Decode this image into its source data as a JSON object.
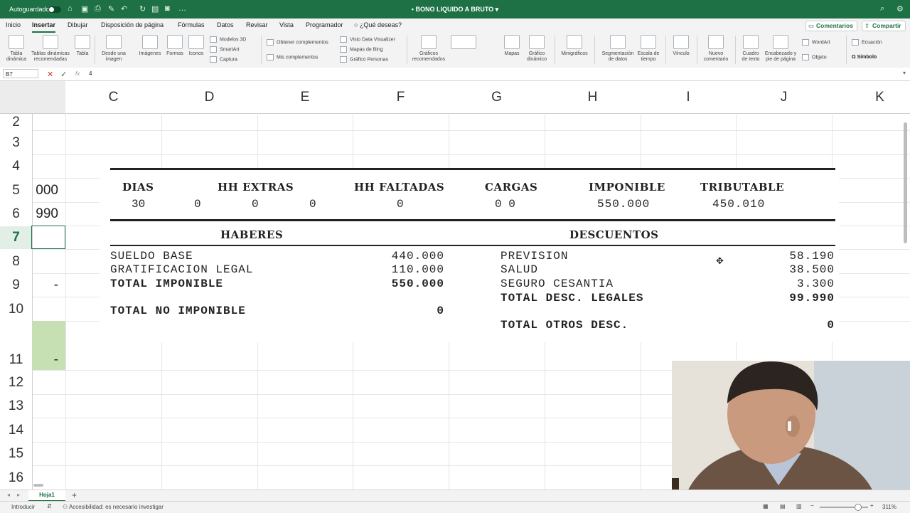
{
  "titlebar": {
    "autosave_label": "Autoguardado",
    "doc_title": "BONO LIQUIDO A BRUTO"
  },
  "tabs": [
    "Inicio",
    "Insertar",
    "Dibujar",
    "Disposición de página",
    "Fórmulas",
    "Datos",
    "Revisar",
    "Vista",
    "Programador",
    "¿Qué deseas?"
  ],
  "active_tab": "Insertar",
  "tab_buttons": {
    "comments": "Comentarios",
    "share": "Compartir"
  },
  "ribbon": {
    "tabla_dinamica": [
      "Tabla",
      "dinámica"
    ],
    "tablas_recomendadas": [
      "Tablas dinámicas",
      "recomendadas"
    ],
    "tabla": "Tabla",
    "desde_imagen": [
      "Desde una",
      "imagen"
    ],
    "imagenes": "Imágenes",
    "formas": "Formas",
    "iconos": "Iconos",
    "modelos3d": "Modelos 3D",
    "smartart": "SmartArt",
    "captura": "Captura",
    "obtener_complementos": "Obtener complementos",
    "mis_complementos": "Mis complementos",
    "visio": "Visio Data Visualizer",
    "bing": "Mapas de Bing",
    "personas": "Gráfico Personas",
    "graficos_recomendados": [
      "Gráficos",
      "recomendados"
    ],
    "mapas": "Mapas",
    "grafico_dinamico": [
      "Gráfico",
      "dinámico"
    ],
    "minigraficos": "Minigráficos",
    "segmentacion": [
      "Segmentación",
      "de datos"
    ],
    "escala_tiempo": [
      "Escala de",
      "tiempo"
    ],
    "vinculo": "Vínculo",
    "nuevo_comentario": [
      "Nuevo",
      "comentario"
    ],
    "cuadro_texto": [
      "Cuadro",
      "de texto"
    ],
    "encabezado": [
      "Encabezado y",
      "pie de página"
    ],
    "wordart": "WordArt",
    "objeto": "Objeto",
    "ecuacion": "Ecuación",
    "simbolo": "Símbolo"
  },
  "formula_bar": {
    "cell_ref": "B7",
    "fx": "fx",
    "value": "4"
  },
  "columns": [
    "C",
    "D",
    "E",
    "F",
    "G",
    "H",
    "I",
    "J",
    "K"
  ],
  "rows": [
    "2",
    "3",
    "4",
    "5",
    "6",
    "7",
    "8",
    "9",
    "10",
    "11",
    "12",
    "13",
    "14",
    "15",
    "16"
  ],
  "col_b_values": {
    "r5": "000",
    "r6": "990",
    "r9": "-",
    "r11": "-"
  },
  "payslip": {
    "headers": [
      "DIAS",
      "HH EXTRAS",
      "HH FALTADAS",
      "CARGAS",
      "IMPONIBLE",
      "TRIBUTABLE"
    ],
    "values": [
      "30",
      "0",
      "0",
      "0",
      "0",
      "0 0",
      "550.000",
      "450.010"
    ],
    "haberes_title": "HABERES",
    "descuentos_title": "DESCUENTOS",
    "haberes": [
      {
        "label": "SUELDO BASE",
        "value": "440.000"
      },
      {
        "label": "GRATIFICACION LEGAL",
        "value": "110.000"
      }
    ],
    "total_imponible": {
      "label": "TOTAL IMPONIBLE",
      "value": "550.000"
    },
    "total_no_imponible": {
      "label": "TOTAL NO IMPONIBLE",
      "value": "0"
    },
    "descuentos": [
      {
        "label": "PREVISION",
        "value": "58.190"
      },
      {
        "label": "SALUD",
        "value": "38.500"
      },
      {
        "label": "SEGURO CESANTIA",
        "value": "3.300"
      }
    ],
    "total_desc_legales": {
      "label": "TOTAL DESC. LEGALES",
      "value": "99.990"
    },
    "total_otros_desc": {
      "label": "TOTAL OTROS DESC.",
      "value": "0"
    }
  },
  "sheet_tab": "Hoja1",
  "status": {
    "mode": "Introducir",
    "accessibility": "Accesibilidad: es necesario investigar",
    "zoom": "311%"
  }
}
